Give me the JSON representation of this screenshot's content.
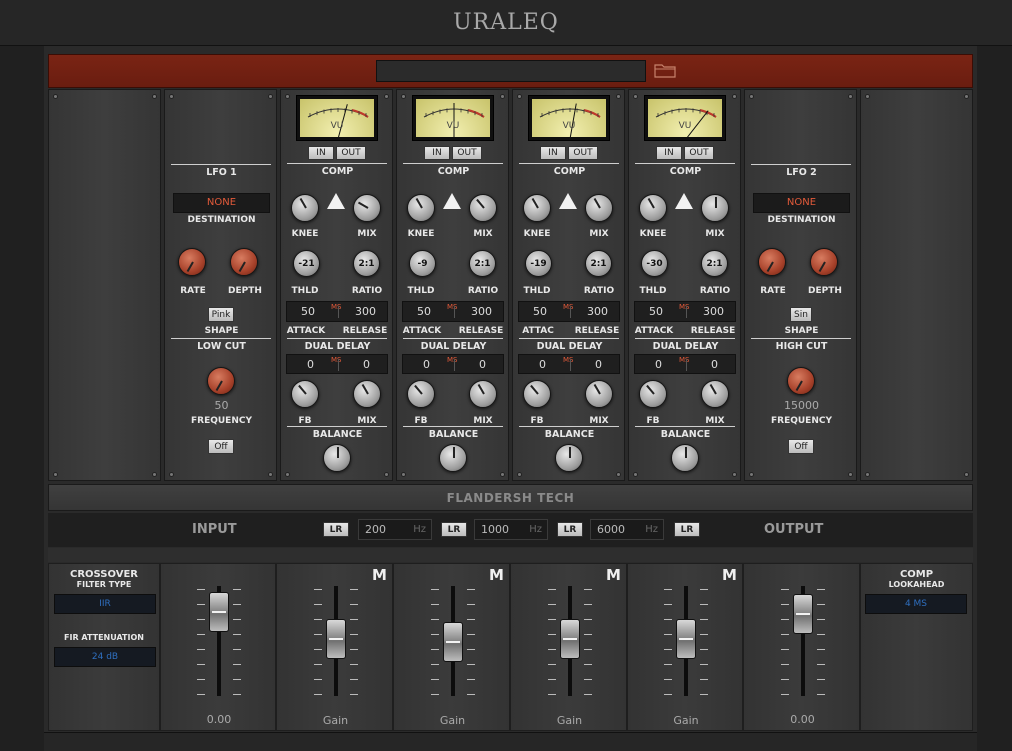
{
  "app": {
    "title": "URALEQ"
  },
  "lfo1": {
    "title": "LFO 1",
    "destination": "NONE",
    "destination_label": "DESTINATION",
    "rate_label": "RATE",
    "depth_label": "DEPTH",
    "shape": "Pink",
    "shape_label": "SHAPE"
  },
  "lowcut": {
    "title": "LOW CUT",
    "value": "50",
    "frequency_label": "FREQUENCY",
    "toggle": "Off"
  },
  "lfo2": {
    "title": "LFO 2",
    "destination": "NONE",
    "destination_label": "DESTINATION",
    "rate_label": "RATE",
    "depth_label": "DEPTH",
    "shape": "Sin",
    "shape_label": "SHAPE"
  },
  "highcut": {
    "title": "HIGH CUT",
    "value": "15000",
    "frequency_label": "FREQUENCY",
    "toggle": "Off"
  },
  "bands": [
    {
      "vu_label": "VU",
      "in": "IN",
      "out": "OUT",
      "comp": "COMP",
      "knee": "KNEE",
      "mix": "MIX",
      "thld_value": "-21",
      "thld": "THLD",
      "ratio_value": "2:1",
      "ratio": "RATIO",
      "attack_value": "50",
      "release_value": "300",
      "ms": "MS",
      "attack": "ATTACK",
      "release": "RELEASE",
      "dual_delay": "DUAL DELAY",
      "delay_l": "0",
      "delay_r": "0",
      "fb": "FB",
      "mix2": "MIX",
      "balance": "BALANCE"
    },
    {
      "vu_label": "VU",
      "in": "IN",
      "out": "OUT",
      "comp": "COMP",
      "knee": "KNEE",
      "mix": "MIX",
      "thld_value": "-9",
      "thld": "THLD",
      "ratio_value": "2:1",
      "ratio": "RATIO",
      "attack_value": "50",
      "release_value": "300",
      "ms": "MS",
      "attack": "ATTACK",
      "release": "RELEASE",
      "dual_delay": "DUAL DELAY",
      "delay_l": "0",
      "delay_r": "0",
      "fb": "FB",
      "mix2": "MIX",
      "balance": "BALANCE"
    },
    {
      "vu_label": "VU",
      "in": "IN",
      "out": "OUT",
      "comp": "COMP",
      "knee": "KNEE",
      "mix": "MIX",
      "thld_value": "-19",
      "thld": "THLD",
      "ratio_value": "2:1",
      "ratio": "RATIO",
      "attack_value": "50",
      "release_value": "300",
      "ms": "MS",
      "attack": "ATTAC",
      "release": "RELEASE",
      "dual_delay": "DUAL DELAY",
      "delay_l": "0",
      "delay_r": "0",
      "fb": "FB",
      "mix2": "MIX",
      "balance": "BALANCE"
    },
    {
      "vu_label": "VU",
      "in": "IN",
      "out": "OUT",
      "comp": "COMP",
      "knee": "KNEE",
      "mix": "MIX",
      "thld_value": "-30",
      "thld": "THLD",
      "ratio_value": "2:1",
      "ratio": "RATIO",
      "attack_value": "50",
      "release_value": "300",
      "ms": "MS",
      "attack": "ATTACK",
      "release": "RELEASE",
      "dual_delay": "DUAL DELAY",
      "delay_l": "0",
      "delay_r": "0",
      "fb": "FB",
      "mix2": "MIX",
      "balance": "BALANCE"
    }
  ],
  "brand": "FLANDERSH TECH",
  "crossover": {
    "input_label": "INPUT",
    "output_label": "OUTPUT",
    "lr": "LR",
    "unit": "Hz",
    "freqs": [
      "200",
      "1000",
      "6000"
    ]
  },
  "crossover_panel": {
    "title": "CROSSOVER",
    "filter_type_label": "FILTER TYPE",
    "filter_type": "IIR",
    "fir_label": "FIR ATTENUATION",
    "fir_value": "24 dB"
  },
  "comp_lookahead": {
    "title": "COMP",
    "subtitle": "LOOKAHEAD",
    "value": "4 MS"
  },
  "faders": {
    "input_value": "0.00",
    "output_value": "0.00",
    "gain_label": "Gain",
    "mute": "M"
  },
  "colors": {
    "accent_red": "#e25a3a",
    "panel_red": "#7a2414",
    "vu_face": "#e9e6a0",
    "lcd_blue": "#2f6fbf"
  }
}
